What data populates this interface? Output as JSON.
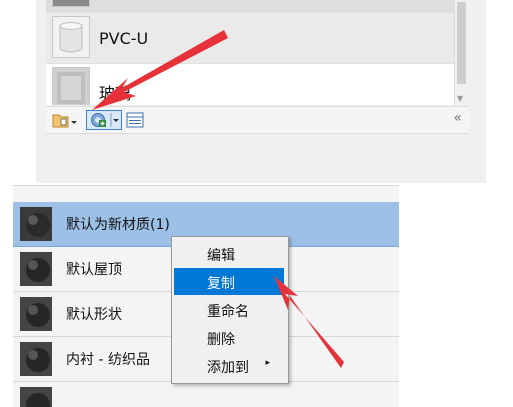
{
  "top_panel": {
    "materials": [
      {
        "label": "PVC-U"
      },
      {
        "label": "玻璃"
      }
    ],
    "toolbar": {
      "library_icon": "library-folder-icon",
      "add_icon": "add-material-icon",
      "panel_icon": "panel-toggle-icon",
      "collapse_label": "«"
    }
  },
  "bottom_panel": {
    "materials": [
      {
        "label": "默认为新材质(1)",
        "selected": true
      },
      {
        "label": "默认屋顶"
      },
      {
        "label": "默认形状"
      },
      {
        "label": "内衬 - 纺织品"
      }
    ]
  },
  "context_menu": {
    "items": [
      {
        "label": "编辑"
      },
      {
        "label": "复制",
        "highlighted": true
      },
      {
        "label": "重命名"
      },
      {
        "label": "删除"
      },
      {
        "label": "添加到",
        "submenu": "▸"
      }
    ]
  },
  "colors": {
    "highlight": "#0078d7",
    "selected_row": "#9dc0e6",
    "annotation_arrow": "#e8323a"
  }
}
